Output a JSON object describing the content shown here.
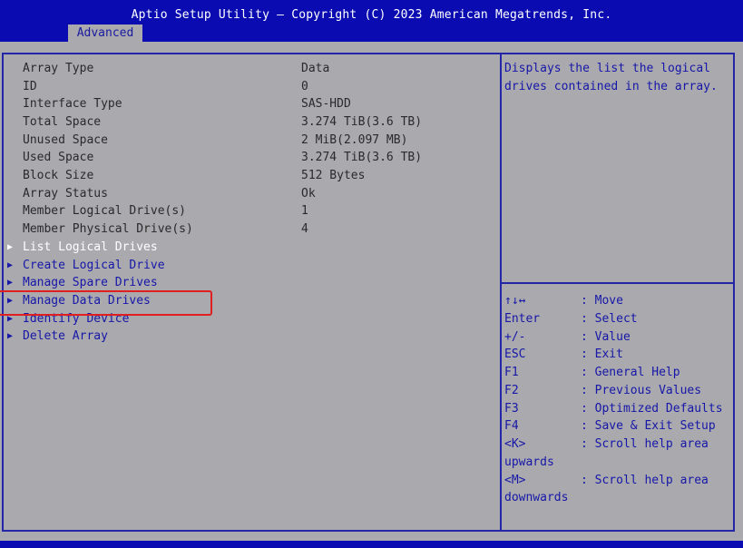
{
  "header": {
    "title": "Aptio Setup Utility – Copyright (C) 2023 American Megatrends, Inc.",
    "tab_label": "Advanced"
  },
  "info_rows": [
    {
      "label": "Array Type",
      "value": "Data"
    },
    {
      "label": "ID",
      "value": "0"
    },
    {
      "label": "Interface Type",
      "value": "SAS-HDD"
    },
    {
      "label": "Total Space",
      "value": "3.274 TiB(3.6 TB)"
    },
    {
      "label": "Unused Space",
      "value": "2 MiB(2.097 MB)"
    },
    {
      "label": "Used Space",
      "value": "3.274 TiB(3.6 TB)"
    },
    {
      "label": "Block Size",
      "value": "512 Bytes"
    },
    {
      "label": "Array Status",
      "value": "Ok"
    },
    {
      "label": "Member Logical Drive(s)",
      "value": "1"
    },
    {
      "label": "Member Physical Drive(s)",
      "value": "4"
    }
  ],
  "menu_items": [
    {
      "label": "List Logical Drives"
    },
    {
      "label": "Create Logical Drive"
    },
    {
      "label": "Manage Spare Drives"
    },
    {
      "label": "Manage Data Drives"
    },
    {
      "label": "Identify Device"
    },
    {
      "label": "Delete Array"
    }
  ],
  "help": {
    "line1": "Displays the list the logical",
    "line2": "drives contained in the array."
  },
  "hotkeys": [
    {
      "key": "↑↓↔",
      "desc": ": Move"
    },
    {
      "key": "Enter",
      "desc": ": Select"
    },
    {
      "key": "+/-",
      "desc": ": Value"
    },
    {
      "key": "ESC",
      "desc": ": Exit"
    },
    {
      "key": "F1",
      "desc": ": General Help"
    },
    {
      "key": "F2",
      "desc": ": Previous Values"
    },
    {
      "key": "F3",
      "desc": ": Optimized Defaults"
    },
    {
      "key": "F4",
      "desc": ": Save & Exit Setup"
    },
    {
      "key": "<K>",
      "desc": ": Scroll help area"
    },
    {
      "key": "upwards",
      "desc": ""
    },
    {
      "key": "<M>",
      "desc": ": Scroll help area"
    },
    {
      "key": "downwards",
      "desc": ""
    }
  ],
  "colors": {
    "title_bar": "#0a0cb2",
    "background": "#a9a9ae",
    "menu_text": "#1717a8",
    "highlight_box": "#e02020"
  }
}
